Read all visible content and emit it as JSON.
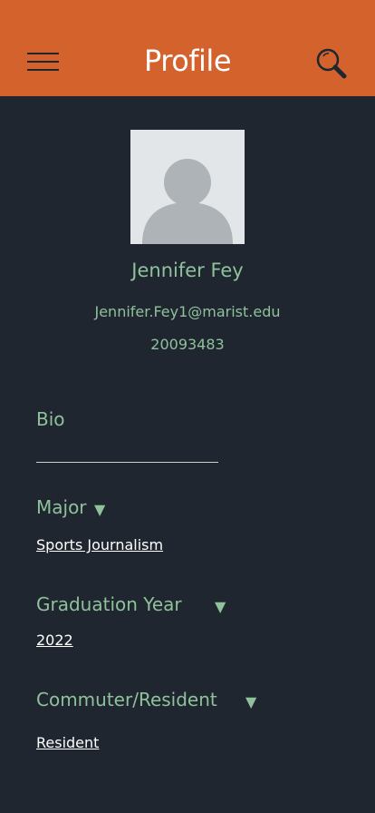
{
  "header": {
    "title": "Profile",
    "menu_icon": "hamburger-menu-icon",
    "search_icon": "search-icon",
    "accent_color": "#d4622c"
  },
  "profile": {
    "avatar_icon": "default-avatar-icon",
    "name": "Jennifer Fey",
    "email": "Jennifer.Fey1@marist.edu",
    "student_id": "20093483"
  },
  "fields": {
    "bio": {
      "label": "Bio",
      "value": ""
    },
    "major": {
      "label": "Major",
      "value": "Sports Journalism"
    },
    "graduation_year": {
      "label": "Graduation Year",
      "value": "2022"
    },
    "commuter_resident": {
      "label": "Commuter/Resident",
      "value": "Resident"
    },
    "dropdown_glyph": "▼"
  },
  "colors": {
    "background": "#1f2630",
    "text_accent": "#8fc19b"
  }
}
